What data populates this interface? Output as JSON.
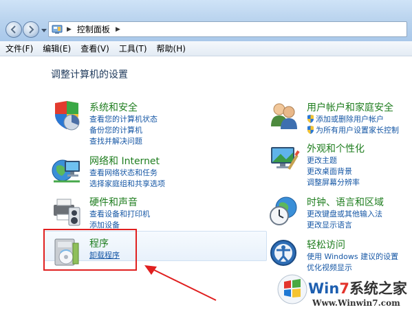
{
  "address_bar": {
    "breadcrumb": "控制面板"
  },
  "menu": [
    {
      "label": "文件(F)"
    },
    {
      "label": "编辑(E)"
    },
    {
      "label": "查看(V)"
    },
    {
      "label": "工具(T)"
    },
    {
      "label": "帮助(H)"
    }
  ],
  "page_title": "调整计算机的设置",
  "categories": {
    "system_security": {
      "title": "系统和安全",
      "icon": "shield-chart-icon",
      "links": [
        "查看您的计算机状态",
        "备份您的计算机",
        "查找并解决问题"
      ]
    },
    "network": {
      "title": "网络和 Internet",
      "icon": "network-globe-icon",
      "links": [
        "查看网络状态和任务",
        "选择家庭组和共享选项"
      ]
    },
    "hardware": {
      "title": "硬件和声音",
      "icon": "printer-speaker-icon",
      "links": [
        "查看设备和打印机",
        "添加设备"
      ]
    },
    "programs": {
      "title": "程序",
      "icon": "programs-box-icon",
      "links": [
        "卸载程序"
      ]
    },
    "user_accounts": {
      "title": "用户帐户和家庭安全",
      "icon": "users-icon",
      "links": [
        "添加或删除用户帐户",
        "为所有用户设置家长控制"
      ]
    },
    "appearance": {
      "title": "外观和个性化",
      "icon": "monitor-brush-icon",
      "links": [
        "更改主题",
        "更改桌面背景",
        "调整屏幕分辨率"
      ]
    },
    "clock_region": {
      "title": "时钟、语言和区域",
      "icon": "clock-globe-icon",
      "links": [
        "更改键盘或其他输入法",
        "更改显示语言"
      ]
    },
    "ease_access": {
      "title": "轻松访问",
      "icon": "ease-of-access-icon",
      "links": [
        "使用 Windows 建议的设置",
        "优化视频显示"
      ]
    }
  },
  "watermark": {
    "brand_win": "Win",
    "brand_seven": "7",
    "brand_rest": "系统之家",
    "url": "Www.Winwin7.com"
  },
  "colors": {
    "category_title": "#1e7d1e",
    "link": "#1657a5",
    "annotation_red": "#e01f1f"
  }
}
